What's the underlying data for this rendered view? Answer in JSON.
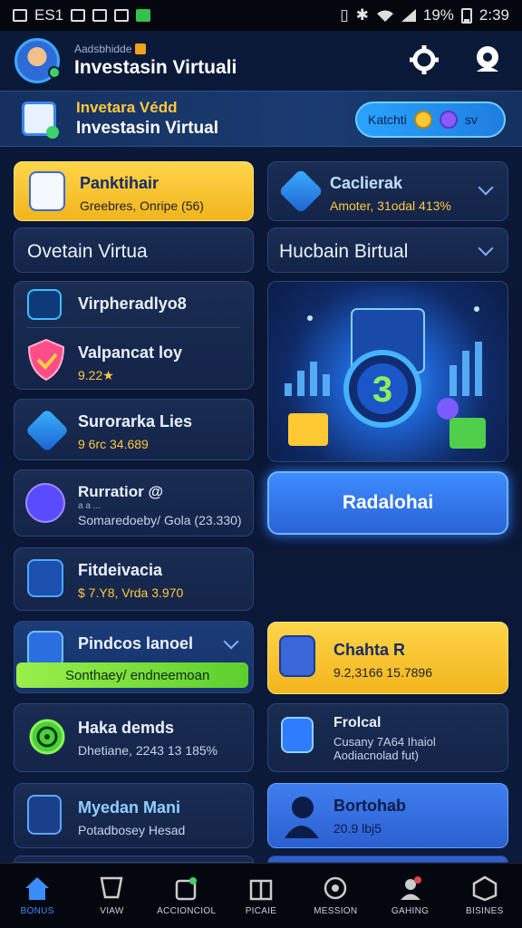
{
  "statusbar": {
    "left_text": "ES1",
    "battery": "19%",
    "time": "2:39"
  },
  "header": {
    "subtitle": "Aadsbhidde",
    "title": "Investasin Virtuali"
  },
  "banner": {
    "line1": "Invetara Védd",
    "line2": "Investasin Virtual",
    "pill_text": "Katchti",
    "pill_suffix": "sv"
  },
  "cards": {
    "left_yellow": {
      "title": "Panktihair",
      "sub": "Greebres, Onripe (56)"
    },
    "right_top": {
      "title": "Caclierak",
      "sub": "Amoter, 31odal 413%"
    },
    "left_wide": {
      "title": "Ovetain Virtua"
    },
    "right_wide": {
      "title": "Hucbain Birtual"
    },
    "list_group": [
      {
        "title": "Virpheradlyo8"
      },
      {
        "title": "Valpancat loy",
        "sub": "9.22★"
      }
    ],
    "left_items": [
      {
        "title": "Surorarka Lies",
        "sub": "9 6rc 34.689"
      },
      {
        "title": "Rurratior @",
        "sub": "Somaredoeby/ Gola (23.330)",
        "sub_small": "a a ..."
      },
      {
        "title": "Fitdeivacia",
        "sub": "$ 7.Y8, Vrda 3.970"
      }
    ],
    "green_card": {
      "title": "Pindcos lanoel",
      "bar": "Sonthaey/ endneemoan"
    },
    "yellow_right": {
      "title": "Chahta R",
      "sub": "9.2,3166 15.7896"
    },
    "row7_left": {
      "title": "Haka demds",
      "sub": "Dhetiane, 2243 13 185%"
    },
    "row7_right": {
      "title": "Frolcal",
      "sub1": "Cusany 7A64 Ihaiol",
      "sub2": "Aodiacnolad fut)"
    },
    "row8_left": {
      "title": "Myedan Mani",
      "sub": "Potadbosey Hesad"
    },
    "row8_right": {
      "title": "Bortohab",
      "sub": "20.9 lbj5"
    }
  },
  "hero": {
    "badge_number": "3",
    "button_label": "Radalohai"
  },
  "bottom_nav": [
    {
      "label": "BONUS",
      "icon": "home-icon"
    },
    {
      "label": "VIAW",
      "icon": "shield-icon"
    },
    {
      "label": "ACCIONCIOL",
      "icon": "wallet-icon"
    },
    {
      "label": "PICAIE",
      "icon": "gift-icon"
    },
    {
      "label": "MESSION",
      "icon": "target-icon"
    },
    {
      "label": "GAHING",
      "icon": "user-icon"
    },
    {
      "label": "BISINES",
      "icon": "building-icon"
    }
  ],
  "colors": {
    "accent": "#2f7cff",
    "gold": "#ffc93c",
    "green": "#3bd36a"
  }
}
